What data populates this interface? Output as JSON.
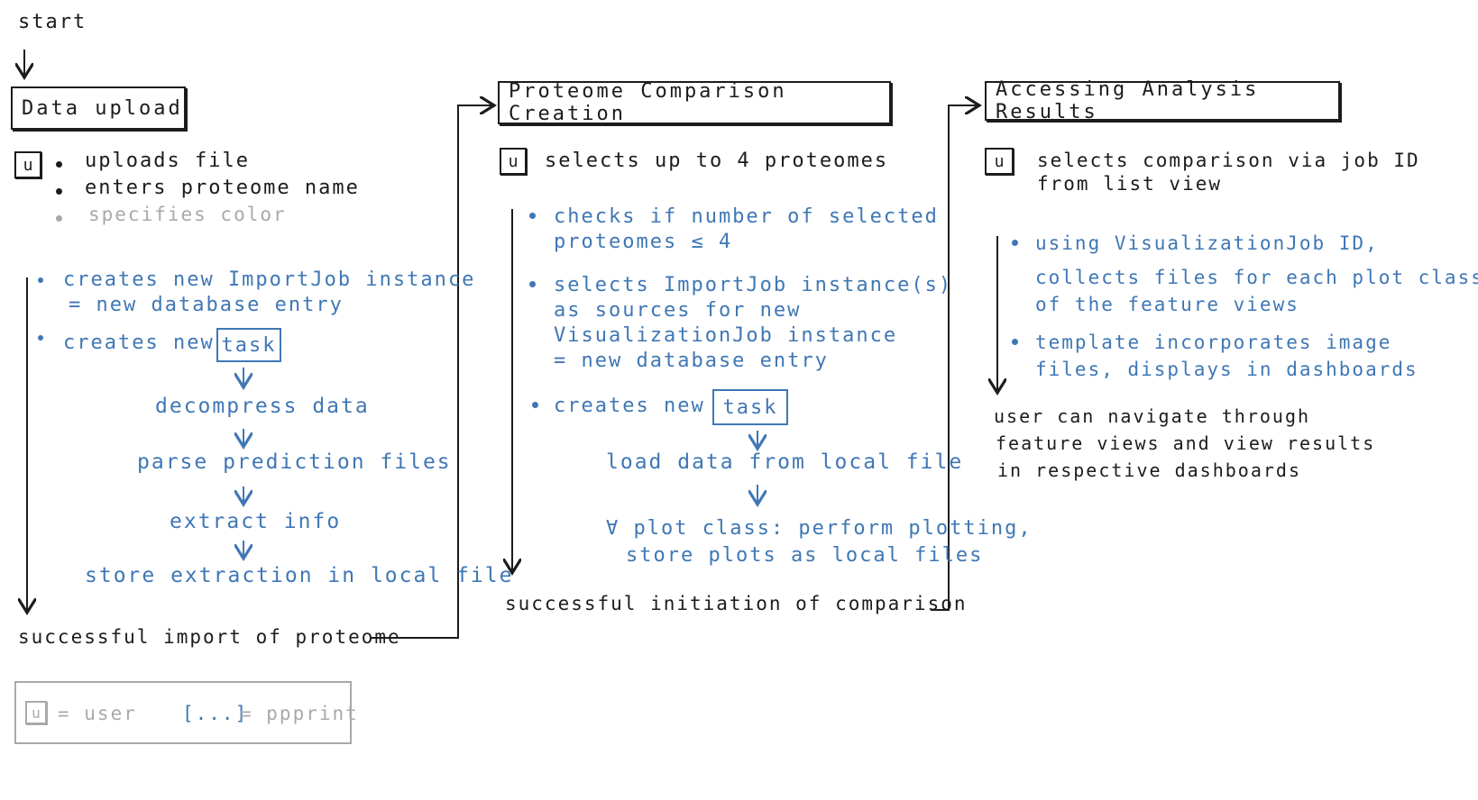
{
  "start": "start",
  "headers": {
    "upload": "Data upload",
    "comparison": "Proteome Comparison Creation",
    "results": "Accessing Analysis Results"
  },
  "user_marker": "u",
  "upload": {
    "user_steps": [
      "uploads file",
      "enters proteome name"
    ],
    "optional_step": "specifies color",
    "system_1a": "creates new ImportJob instance",
    "system_1b": "= new database entry",
    "system_2": "creates new",
    "task_label": "task",
    "flow": [
      "decompress data",
      "parse prediction files",
      "extract info",
      "store extraction in local file"
    ],
    "outcome": "successful import of proteome"
  },
  "comparison": {
    "user_step": "selects up to 4 proteomes",
    "system_1a": "checks if number of selected",
    "system_1b": "proteomes ≤ 4",
    "system_2a": "selects ImportJob instance(s)",
    "system_2b": "as sources for new",
    "system_2c": "VisualizationJob instance",
    "system_2d": "= new database entry",
    "system_3": "creates new",
    "task_label": "task",
    "flow_1": "load data from local file",
    "flow_2a": "∀ plot class: perform plotting,",
    "flow_2b": "store plots as local files",
    "outcome": "successful initiation of comparison"
  },
  "results": {
    "user_step_a": "selects comparison via job ID",
    "user_step_b": "from list view",
    "system_1a": "using VisualizationJob ID,",
    "system_1b": "collects files for each plot class",
    "system_1c": "of the feature views",
    "system_2a": "template incorporates image",
    "system_2b": "files, displays in dashboards",
    "outcome_a": "user can navigate through",
    "outcome_b": "feature views and view results",
    "outcome_c": "in respective dashboards"
  },
  "legend": {
    "user_symbol": "u",
    "user_text": "= user",
    "system_symbol": "[...]",
    "system_text": "= ppprint"
  },
  "colors": {
    "ink": "#1c1c1c",
    "system": "#3f77b5",
    "optional": "#a9a9a9"
  }
}
